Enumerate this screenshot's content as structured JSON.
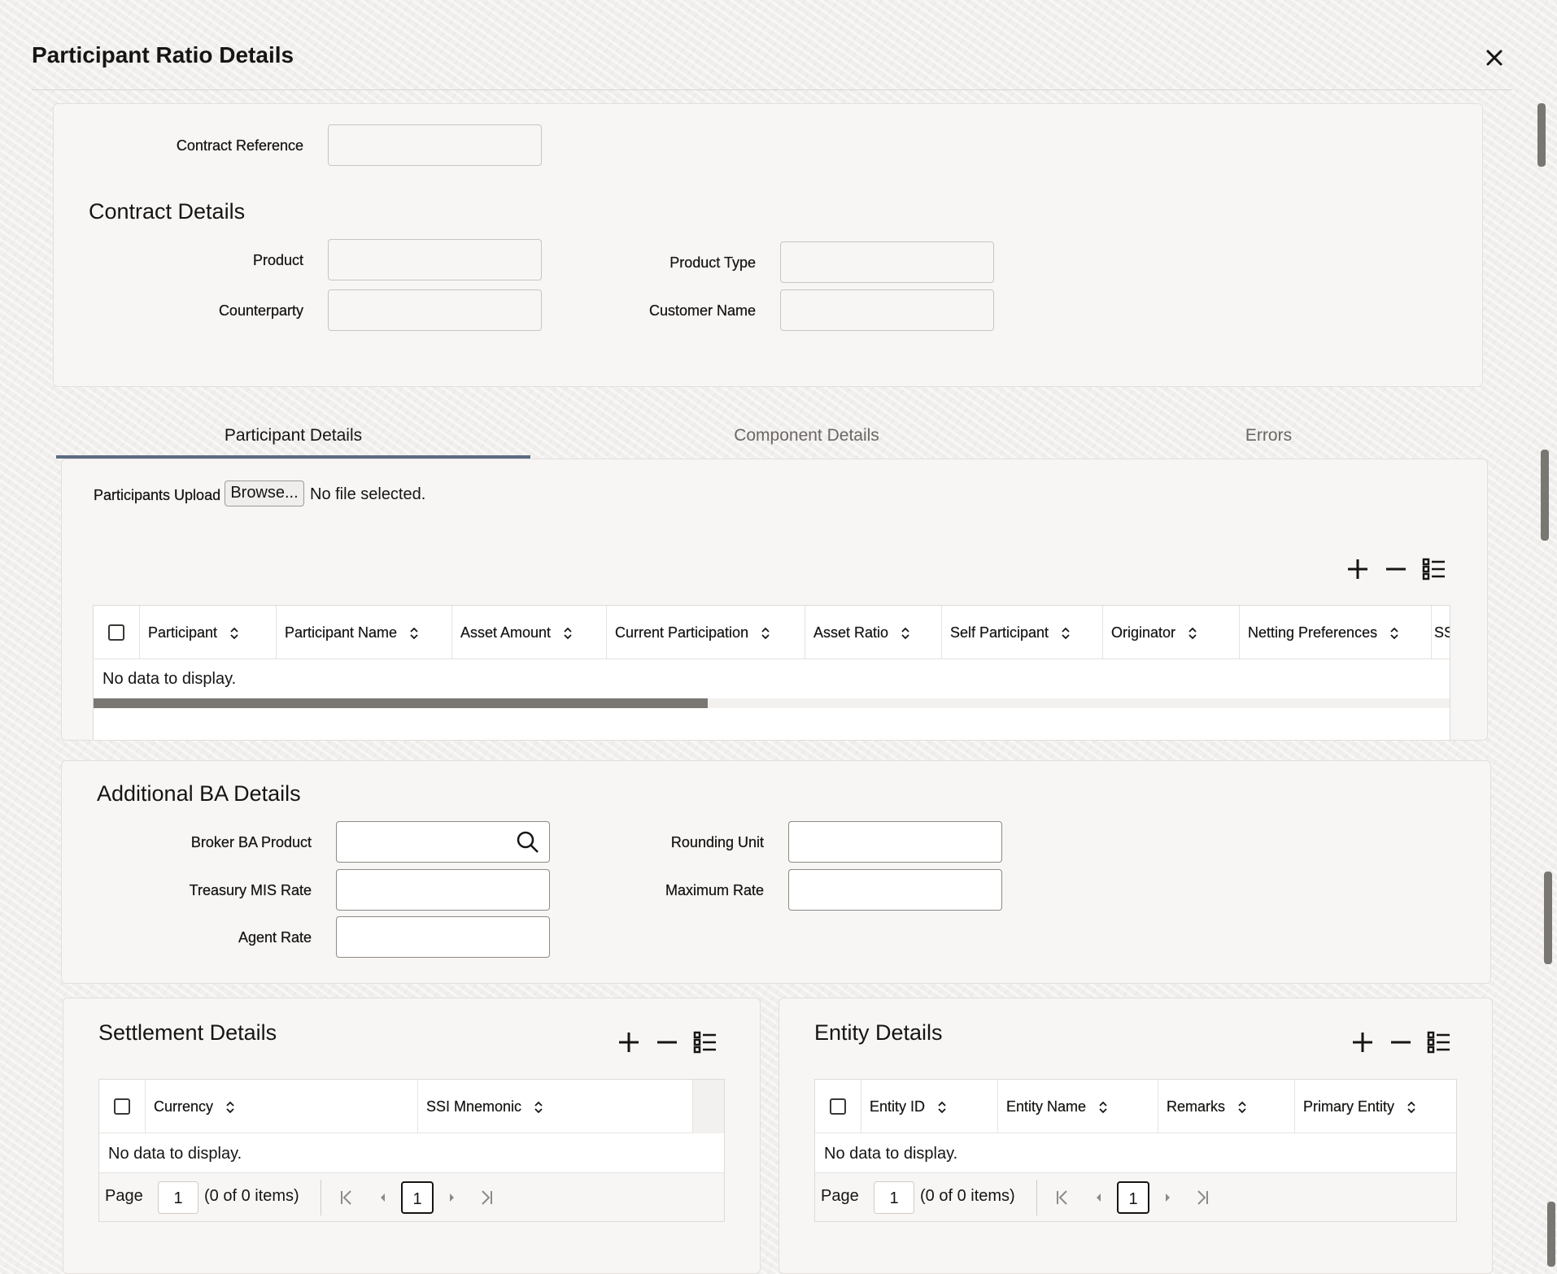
{
  "dialog": {
    "title": "Participant Ratio Details",
    "close_label": "✕"
  },
  "contract": {
    "contract_reference_label": "Contract Reference",
    "section_title": "Contract Details",
    "product_label": "Product",
    "product_type_label": "Product Type",
    "counterparty_label": "Counterparty",
    "customer_name_label": "Customer Name"
  },
  "tabs": [
    {
      "label": "Participant Details",
      "active": true
    },
    {
      "label": "Component Details",
      "active": false
    },
    {
      "label": "Errors",
      "active": false
    }
  ],
  "participants": {
    "upload_label": "Participants Upload",
    "browse_label": "Browse...",
    "file_status": "No file selected.",
    "columns": [
      "Participant",
      "Participant Name",
      "Asset Amount",
      "Current Participation",
      "Asset Ratio",
      "Self Participant",
      "Originator",
      "Netting Preferences",
      "SS"
    ],
    "no_data": "No data to display.",
    "horizontal_scroll_fraction": 0.45
  },
  "additional_ba": {
    "section_title": "Additional BA Details",
    "broker_ba_product_label": "Broker BA Product",
    "rounding_unit_label": "Rounding Unit",
    "treasury_mis_rate_label": "Treasury MIS Rate",
    "maximum_rate_label": "Maximum Rate",
    "agent_rate_label": "Agent Rate"
  },
  "settlement": {
    "section_title": "Settlement Details",
    "columns": [
      "Currency",
      "SSI Mnemonic"
    ],
    "no_data": "No data to display.",
    "page_label": "Page",
    "page_value": "1",
    "items_text": "(0 of 0 items)",
    "current_page": "1"
  },
  "entity": {
    "section_title": "Entity Details",
    "columns": [
      "Entity ID",
      "Entity Name",
      "Remarks",
      "Primary Entity"
    ],
    "no_data": "No data to display.",
    "page_label": "Page",
    "page_value": "1",
    "items_text": "(0 of 0 items)",
    "current_page": "1"
  },
  "icons": [
    "close-icon",
    "add-icon",
    "remove-icon",
    "column-list-icon",
    "search-icon",
    "sort-icon",
    "first-page-icon",
    "prev-page-icon",
    "next-page-icon",
    "last-page-icon"
  ],
  "colors": {
    "tab_underline": "#5b6b82",
    "panel_bg": "#f7f6f5",
    "page_bg": "#f1efed"
  }
}
